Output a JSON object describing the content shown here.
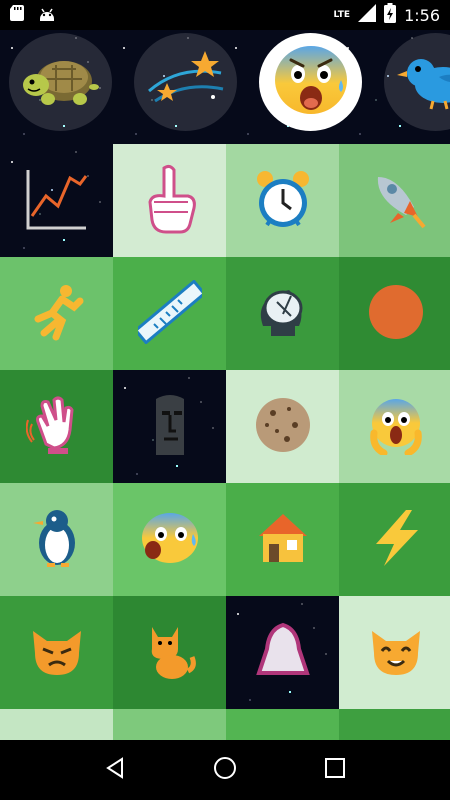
{
  "status_bar": {
    "time": "1:56",
    "network": "LTE",
    "icons": [
      "sd-card-icon",
      "android-icon",
      "cell-signal-icon",
      "battery-charging-icon"
    ]
  },
  "categories": [
    {
      "name": "turtle-icon",
      "selected": false
    },
    {
      "name": "space-icon",
      "selected": false
    },
    {
      "name": "fearful-face-icon",
      "selected": true
    },
    {
      "name": "bird-icon",
      "selected": false
    }
  ],
  "grid": {
    "cells": [
      {
        "icon": "chart-increasing-icon",
        "bg": "space"
      },
      {
        "icon": "index-pointing-up-icon",
        "bg": "#d3ebd2"
      },
      {
        "icon": "alarm-clock-icon",
        "bg": "#a3d8a1"
      },
      {
        "icon": "rocket-icon",
        "bg": "#7dc47b"
      },
      {
        "icon": "person-running-icon",
        "bg": "#6cc26b"
      },
      {
        "icon": "ruler-icon",
        "bg": "#4baf4a"
      },
      {
        "icon": "satellite-antenna-icon",
        "bg": "#3a9a3d"
      },
      {
        "icon": "orange-circle-icon",
        "bg": "#2f8b33"
      },
      {
        "icon": "waving-hand-icon",
        "bg": "#2e8a33"
      },
      {
        "icon": "moai-icon",
        "bg": "space"
      },
      {
        "icon": "cookie-icon",
        "bg": "#d0ebcf"
      },
      {
        "icon": "screaming-face-icon",
        "bg": "#a8daa6"
      },
      {
        "icon": "penguin-icon",
        "bg": "#8ed08c"
      },
      {
        "icon": "anxious-face-icon",
        "bg": "#6ac568"
      },
      {
        "icon": "house-icon",
        "bg": "#4aae49"
      },
      {
        "icon": "high-voltage-icon",
        "bg": "#3b9d3d"
      },
      {
        "icon": "pouting-cat-icon",
        "bg": "#3a9b3c"
      },
      {
        "icon": "cat-icon",
        "bg": "#2d8832"
      },
      {
        "icon": "bell-icon",
        "bg": "space"
      },
      {
        "icon": "smiling-cat-icon",
        "bg": "#d1ecd0"
      },
      {
        "icon": "partial-icon",
        "bg": "#c4e6c3"
      },
      {
        "icon": "partial-icon",
        "bg": "#7ec97c"
      },
      {
        "icon": "partial-icon",
        "bg": "#53b552"
      },
      {
        "icon": "partial-icon",
        "bg": "#3e9f40"
      }
    ]
  },
  "nav_bar": {
    "buttons": [
      "back-button",
      "home-button",
      "recents-button"
    ]
  }
}
